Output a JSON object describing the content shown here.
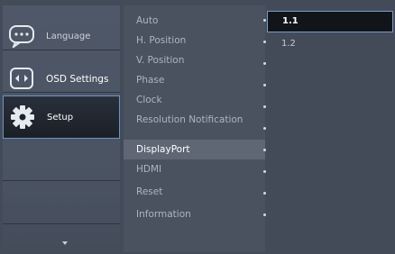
{
  "nav": {
    "items": [
      {
        "label": "Language",
        "icon": "speech-bubble-icon"
      },
      {
        "label": "OSD Settings",
        "icon": "monitor-settings-icon"
      },
      {
        "label": "Setup",
        "icon": "gear-icon"
      }
    ],
    "more_icon": "chevron-down-icon"
  },
  "submenu": {
    "items": [
      {
        "label": "Auto"
      },
      {
        "label": "H. Position"
      },
      {
        "label": "V. Position"
      },
      {
        "label": "Phase"
      },
      {
        "label": "Clock"
      },
      {
        "label": "Resolution Notification"
      },
      {
        "label": "DisplayPort"
      },
      {
        "label": "HDMI"
      },
      {
        "label": "Reset"
      },
      {
        "label": "Information"
      }
    ]
  },
  "values": {
    "options": [
      {
        "label": "1.1",
        "selected": true
      },
      {
        "label": "1.2",
        "selected": false
      }
    ]
  },
  "colors": {
    "background": "#434b59",
    "selection_border": "#6d93c6",
    "selected_value_bg": "#111419"
  }
}
